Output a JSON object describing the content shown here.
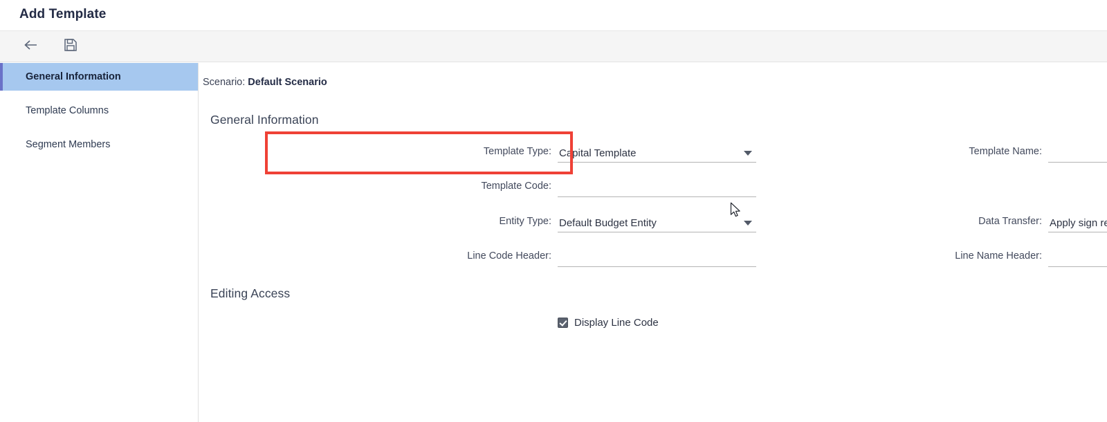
{
  "window": {
    "title": "Add Template"
  },
  "toolbar": {
    "back_label": "Back",
    "save_label": "Save"
  },
  "sidebar": {
    "items": [
      {
        "label": "General Information",
        "active": true
      },
      {
        "label": "Template Columns",
        "active": false
      },
      {
        "label": "Segment Members",
        "active": false
      }
    ]
  },
  "content": {
    "scenario_label": "Scenario:",
    "scenario_value": "Default Scenario",
    "sections": {
      "general": "General Information",
      "editing": "Editing Access"
    },
    "fields": {
      "template_type": {
        "label": "Template Type:",
        "value": "Capital Template",
        "type": "select"
      },
      "template_name": {
        "label": "Template Name:",
        "value": "",
        "type": "text"
      },
      "template_code": {
        "label": "Template Code:",
        "value": "",
        "type": "text"
      },
      "data_transfer": {
        "label": "Data Transfer:",
        "value": "Apply sign reversal",
        "type": "select"
      },
      "entity_type": {
        "label": "Entity Type:",
        "value": "Default Budget Entity",
        "type": "select"
      },
      "line_code_header": {
        "label": "Line Code Header:",
        "value": "",
        "type": "text"
      },
      "line_name_header": {
        "label": "Line Name Header:",
        "value": "",
        "type": "text"
      }
    },
    "checkbox": {
      "label": "Display Line Code",
      "checked": true
    }
  },
  "annotation": {
    "color": "#ef4136",
    "target": "template-type-field"
  },
  "icons": {
    "back": "back-arrow-icon",
    "save": "floppy-disk-save-icon",
    "dropdown": "chevron-down-icon",
    "cursor": "mouse-pointer-icon"
  }
}
